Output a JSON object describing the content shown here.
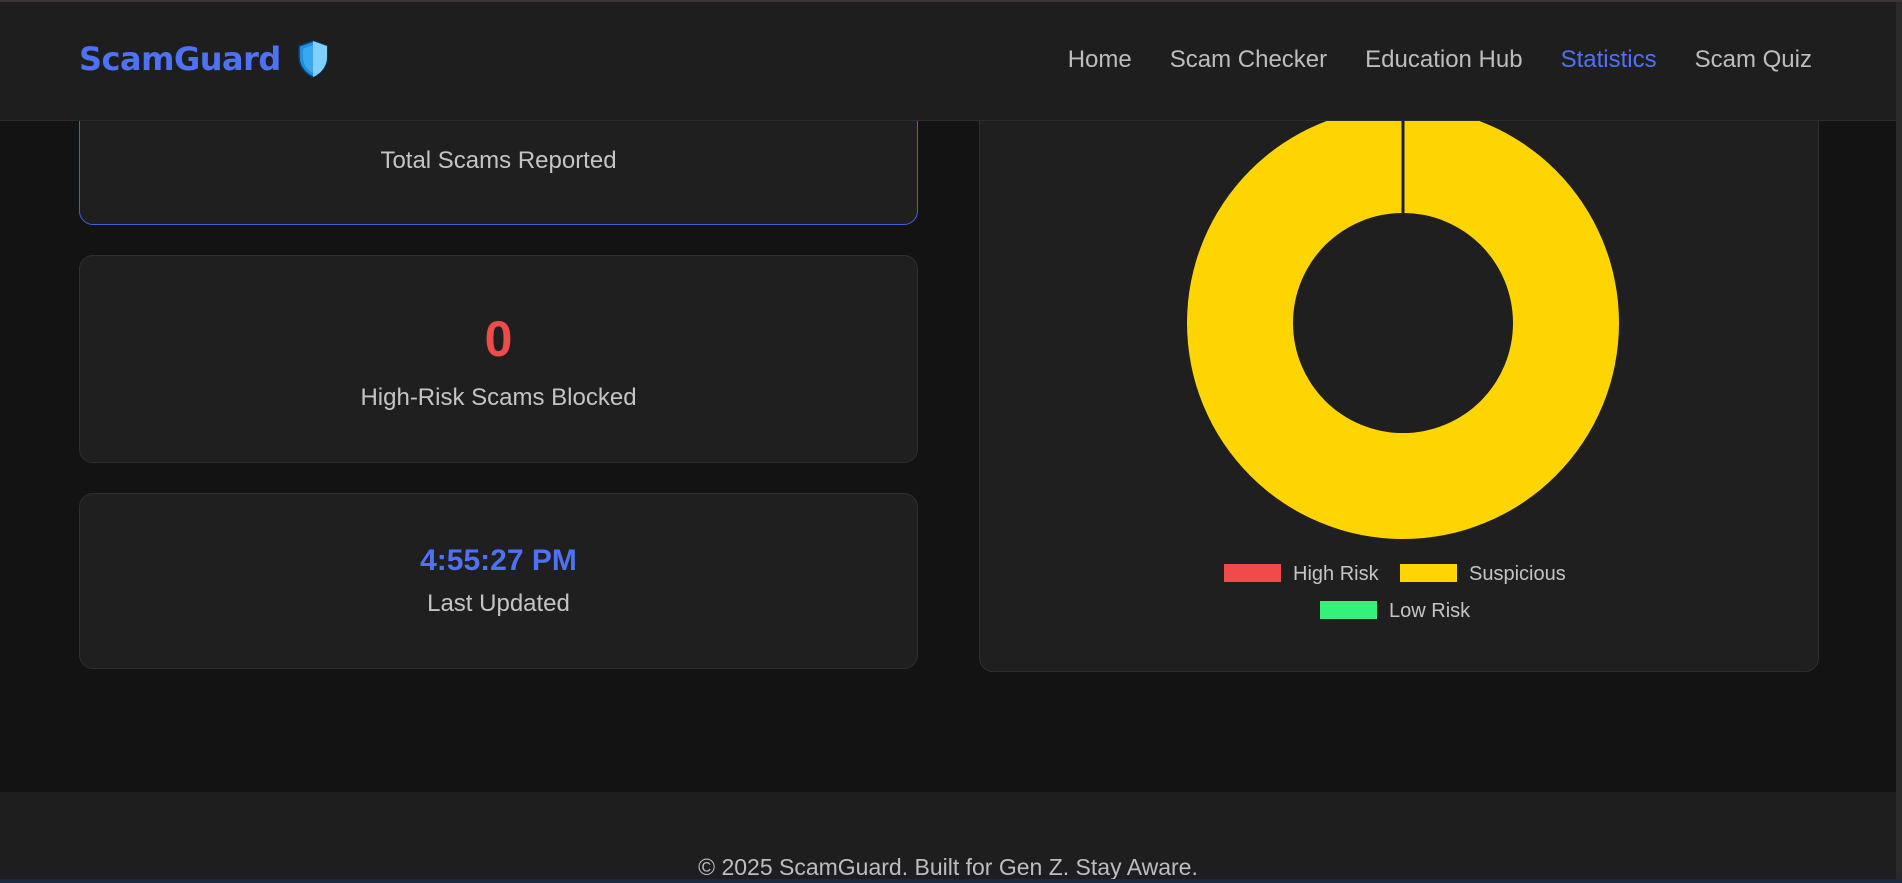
{
  "header": {
    "brand": "ScamGuard",
    "shield_icon": "shield-icon",
    "nav": [
      {
        "label": "Home",
        "active": false
      },
      {
        "label": "Scam Checker",
        "active": false
      },
      {
        "label": "Education Hub",
        "active": false
      },
      {
        "label": "Statistics",
        "active": true
      },
      {
        "label": "Scam Quiz",
        "active": false
      }
    ]
  },
  "stats": {
    "total_label": "Total Scams Reported",
    "high_risk_value": "0",
    "high_risk_label": "High-Risk Scams Blocked",
    "last_updated_value": "4:55:27 PM",
    "last_updated_label": "Last Updated"
  },
  "chart_data": {
    "type": "pie",
    "categories": [
      "High Risk",
      "Suspicious",
      "Low Risk"
    ],
    "values": [
      0,
      1,
      0
    ],
    "colors": [
      "#f24a4a",
      "#ffd500",
      "#35f07a"
    ],
    "legend_position": "bottom"
  },
  "footer": {
    "text": "© 2025 ScamGuard. Built for Gen Z. Stay Aware."
  },
  "colors": {
    "accent": "#4f72f5",
    "danger": "#ef4b4b",
    "background": "#131313",
    "card": "#1f1f1f"
  }
}
